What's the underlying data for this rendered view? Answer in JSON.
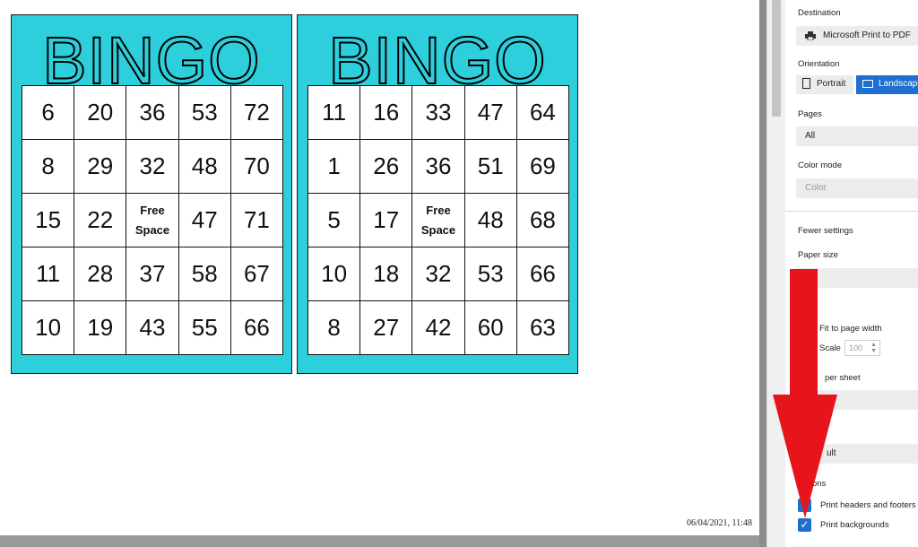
{
  "preview": {
    "timestamp": "06/04/2021, 11:48",
    "cards": [
      {
        "title": "BINGO",
        "rows": [
          [
            "6",
            "20",
            "36",
            "53",
            "72"
          ],
          [
            "8",
            "29",
            "32",
            "48",
            "70"
          ],
          [
            "15",
            "22",
            "Free Space",
            "47",
            "71"
          ],
          [
            "11",
            "28",
            "37",
            "58",
            "67"
          ],
          [
            "10",
            "19",
            "43",
            "55",
            "66"
          ]
        ]
      },
      {
        "title": "BINGO",
        "rows": [
          [
            "11",
            "16",
            "33",
            "47",
            "64"
          ],
          [
            "1",
            "26",
            "36",
            "51",
            "69"
          ],
          [
            "5",
            "17",
            "Free Space",
            "48",
            "68"
          ],
          [
            "10",
            "18",
            "32",
            "53",
            "66"
          ],
          [
            "8",
            "27",
            "42",
            "60",
            "63"
          ]
        ]
      }
    ],
    "card_color": "#2ecfdc"
  },
  "settings": {
    "destination_label": "Destination",
    "destination_value": "Microsoft Print to PDF",
    "orientation_label": "Orientation",
    "portrait_label": "Portrait",
    "landscape_label": "Landscape",
    "pages_label": "Pages",
    "pages_value": "All",
    "color_mode_label": "Color mode",
    "color_mode_value": "Color",
    "fewer_settings_label": "Fewer settings",
    "paper_size_label": "Paper size",
    "fit_label": "Fit to page width",
    "scale_label": "Scale",
    "scale_value": "100",
    "per_sheet_label": "per sheet",
    "margins_value": "ult",
    "options_label": "ons",
    "print_headers_label": "Print headers and footers",
    "print_backgrounds_label": "Print backgrounds",
    "accent_color": "#1f6fd0"
  },
  "overlay": {
    "arrow_color": "#e8141c"
  }
}
